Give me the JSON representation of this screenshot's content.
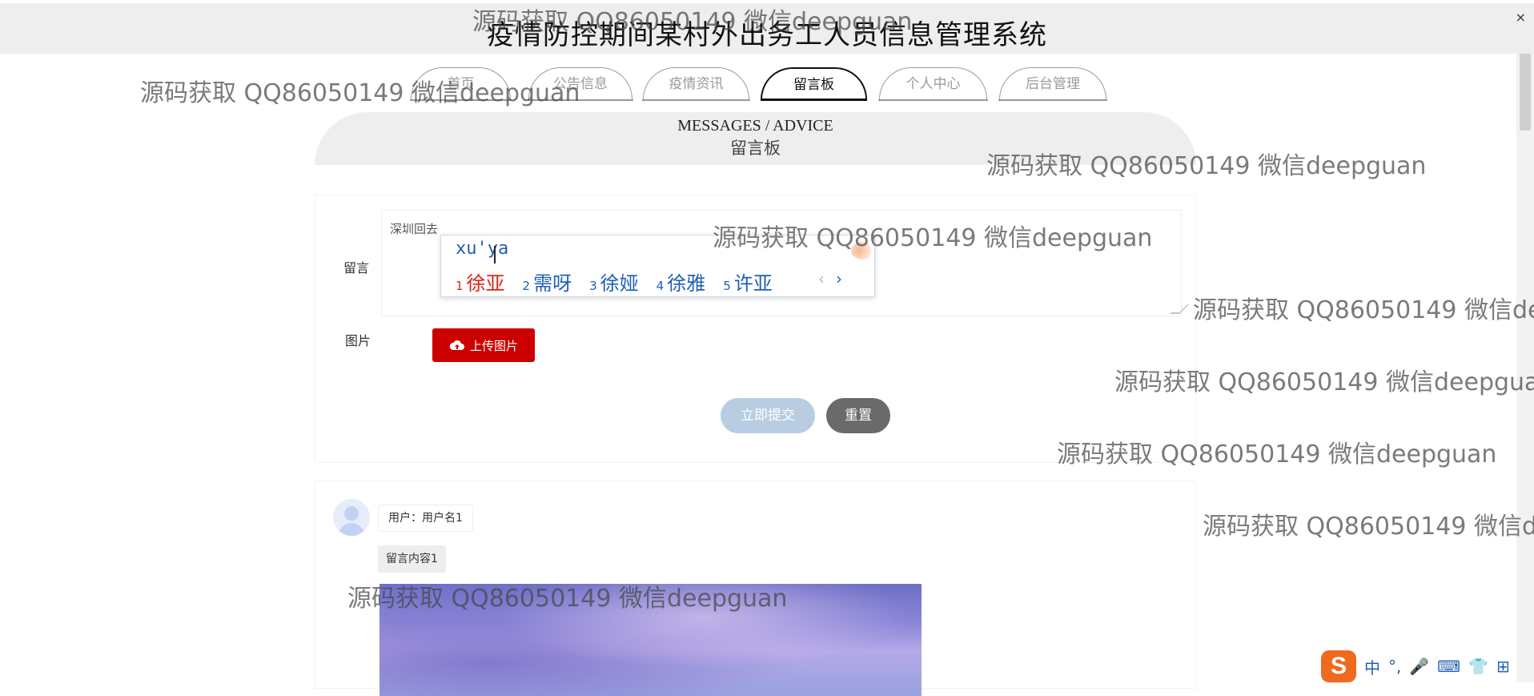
{
  "header": {
    "title": "疫情防控期间某村外出务工人员信息管理系统",
    "close_label": "×"
  },
  "nav": {
    "tabs": [
      {
        "label": "首页",
        "active": false
      },
      {
        "label": "公告信息",
        "active": false
      },
      {
        "label": "疫情资讯",
        "active": false
      },
      {
        "label": "留言板",
        "active": true
      },
      {
        "label": "个人中心",
        "active": false
      },
      {
        "label": "后台管理",
        "active": false
      }
    ]
  },
  "section": {
    "title_en": "MESSAGES / ADVICE",
    "title_cn": "留言板"
  },
  "form": {
    "message_label": "留言",
    "message_value": "深圳回去",
    "image_label": "图片",
    "upload_label": "上传图片",
    "submit_label": "立即提交",
    "reset_label": "重置"
  },
  "ime": {
    "input": "xu'ya",
    "candidates": [
      {
        "num": "1",
        "word": "徐亚"
      },
      {
        "num": "2",
        "word": "需呀"
      },
      {
        "num": "3",
        "word": "徐娅"
      },
      {
        "num": "4",
        "word": "徐雅"
      },
      {
        "num": "5",
        "word": "许亚"
      }
    ],
    "prev": "‹",
    "next": "›"
  },
  "messages": [
    {
      "user": "用户：用户名1",
      "content": "留言内容1"
    }
  ],
  "watermark": "源码获取 QQ86050149 微信deepguan",
  "tray": {
    "logo": "S",
    "items": [
      "中",
      "°,",
      "🎤",
      "⌨",
      "👕",
      "⊞"
    ]
  },
  "colors": {
    "upload": "#cc0000",
    "submit": "#b8cde2",
    "reset": "#6a6a6a",
    "ime_highlight": "#d8261a",
    "ime_text": "#1f5fb4"
  }
}
